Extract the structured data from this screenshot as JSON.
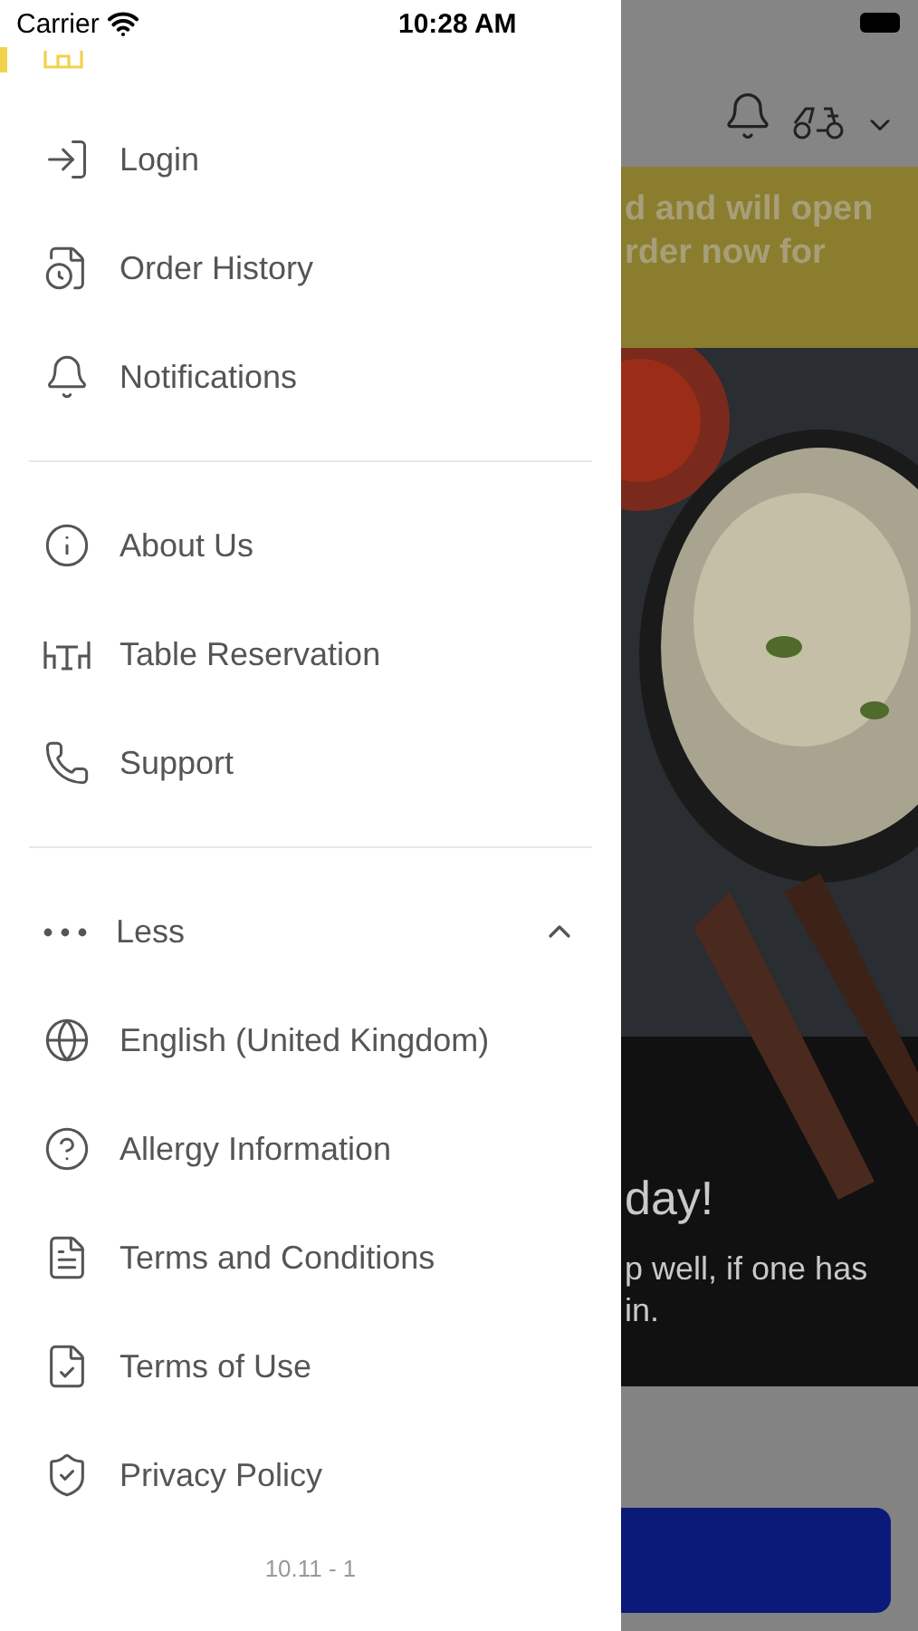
{
  "status_bar": {
    "carrier": "Carrier",
    "time": "10:28 AM"
  },
  "drawer": {
    "sections": [
      {
        "items": [
          {
            "kind": "home",
            "selected": true
          },
          {
            "label": "Login",
            "kind": "login",
            "selected": false
          },
          {
            "label": "Order History",
            "kind": "history",
            "selected": false
          },
          {
            "label": "Notifications",
            "kind": "bell",
            "selected": false
          }
        ]
      },
      {
        "items": [
          {
            "label": "About Us",
            "kind": "info",
            "selected": false
          },
          {
            "label": "Table Reservation",
            "kind": "table",
            "selected": false
          },
          {
            "label": "Support",
            "kind": "phone",
            "selected": false
          }
        ]
      }
    ],
    "more": {
      "label": "Less",
      "expanded": true,
      "children": [
        {
          "label": "English (United Kingdom)",
          "kind": "globe",
          "selected": false
        },
        {
          "label": "Allergy Information",
          "kind": "help",
          "selected": false
        },
        {
          "label": "Terms and Conditions",
          "kind": "document",
          "selected": false
        },
        {
          "label": "Terms of Use",
          "kind": "checkdoc",
          "selected": false
        },
        {
          "label": "Privacy Policy",
          "kind": "privacy",
          "selected": false
        }
      ]
    },
    "version": "10.11 - 1"
  },
  "background": {
    "banner_lines": [
      "d and will open",
      "rder now for"
    ],
    "hero_title": "day!",
    "hero_lines": [
      "p well, if one has",
      "in."
    ]
  }
}
